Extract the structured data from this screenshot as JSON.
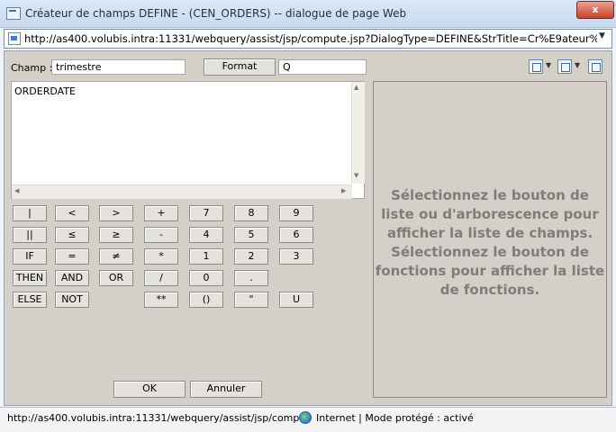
{
  "window": {
    "title": "Créateur de champs DEFINE - (CEN_ORDERS) -- dialogue de page Web",
    "close_glyph": "x",
    "url": "http://as400.volubis.intra:11331/webquery/assist/jsp/compute.jsp?DialogType=DEFINE&StrTitle=Cr%E9ateur%20de%2"
  },
  "form": {
    "champ_label": "Champ :",
    "champ_value": "trimestre",
    "format_button": "Format",
    "format_value": "Q",
    "expression": "ORDERDATE"
  },
  "keypad": [
    [
      {
        "key": "btn-bar",
        "label": "|"
      },
      {
        "key": "btn-lt",
        "label": "<"
      },
      {
        "key": "btn-gt",
        "label": ">"
      },
      {
        "key": "btn-plus",
        "label": "+"
      },
      {
        "key": "btn-7",
        "label": "7"
      },
      {
        "key": "btn-8",
        "label": "8"
      },
      {
        "key": "btn-9",
        "label": "9"
      }
    ],
    [
      {
        "key": "btn-double-bar",
        "label": "||"
      },
      {
        "key": "btn-le",
        "label": "≤"
      },
      {
        "key": "btn-ge",
        "label": "≥"
      },
      {
        "key": "btn-minus",
        "label": "-"
      },
      {
        "key": "btn-4",
        "label": "4"
      },
      {
        "key": "btn-5",
        "label": "5"
      },
      {
        "key": "btn-6",
        "label": "6"
      }
    ],
    [
      {
        "key": "btn-if",
        "label": "IF"
      },
      {
        "key": "btn-eq",
        "label": "="
      },
      {
        "key": "btn-ne",
        "label": "≠"
      },
      {
        "key": "btn-mul",
        "label": "*"
      },
      {
        "key": "btn-1",
        "label": "1"
      },
      {
        "key": "btn-2",
        "label": "2"
      },
      {
        "key": "btn-3",
        "label": "3"
      }
    ],
    [
      {
        "key": "btn-then",
        "label": "THEN"
      },
      {
        "key": "btn-and",
        "label": "AND"
      },
      {
        "key": "btn-or",
        "label": "OR"
      },
      {
        "key": "btn-div",
        "label": "/"
      },
      {
        "key": "btn-0",
        "label": "0"
      },
      {
        "key": "btn-dot",
        "label": "."
      }
    ],
    [
      {
        "key": "btn-else",
        "label": "ELSE"
      },
      {
        "key": "btn-not",
        "label": "NOT"
      },
      {
        "key": "btn-pow",
        "label": "**"
      },
      {
        "key": "btn-paren",
        "label": "()"
      },
      {
        "key": "btn-quote",
        "label": "\""
      },
      {
        "key": "btn-u",
        "label": "U"
      }
    ]
  ],
  "buttons": {
    "ok": "OK",
    "cancel": "Annuler"
  },
  "panel": {
    "message": "Sélectionnez le bouton de liste ou d'arborescence pour afficher la liste de champs. Sélectionnez le bouton de fonctions pour afficher la liste de fonctions."
  },
  "statusbar": {
    "url": "http://as400.volubis.intra:11331/webquery/assist/jsp/compu",
    "zone": "Internet | Mode protégé : activé"
  }
}
